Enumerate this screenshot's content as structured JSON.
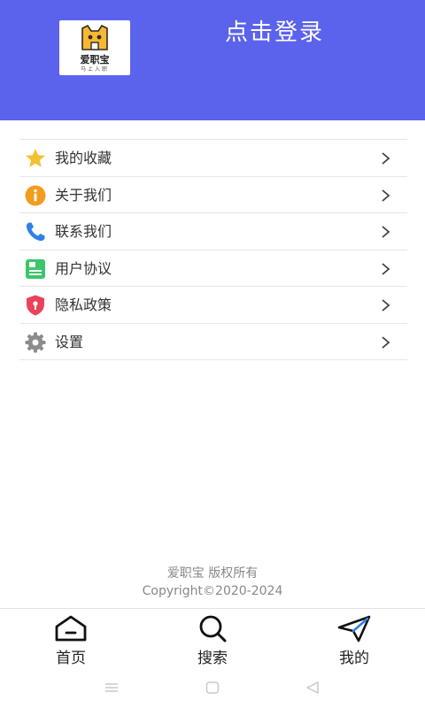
{
  "header": {
    "logo_name": "爱职宝",
    "logo_slogan": "马上入职",
    "login_label": "点击登录",
    "background_color": "#5b63ec"
  },
  "menu": {
    "items": [
      {
        "label": "我的收藏",
        "icon": "star-icon",
        "icon_color": "#f3c232"
      },
      {
        "label": "关于我们",
        "icon": "info-icon",
        "icon_color": "#f39c1e"
      },
      {
        "label": "联系我们",
        "icon": "phone-icon",
        "icon_color": "#2f7fe8"
      },
      {
        "label": "用户协议",
        "icon": "document-icon",
        "icon_color": "#3cc56b"
      },
      {
        "label": "隐私政策",
        "icon": "shield-icon",
        "icon_color": "#e8435a"
      },
      {
        "label": "设置",
        "icon": "gear-icon",
        "icon_color": "#8c8c8c"
      }
    ]
  },
  "footer": {
    "company": "爱职宝  版权所有",
    "copyright": "Copyright©2020-2024"
  },
  "bottom_nav": {
    "items": [
      {
        "label": "首页",
        "icon": "home-icon"
      },
      {
        "label": "搜索",
        "icon": "search-icon"
      },
      {
        "label": "我的",
        "icon": "send-icon"
      }
    ]
  }
}
